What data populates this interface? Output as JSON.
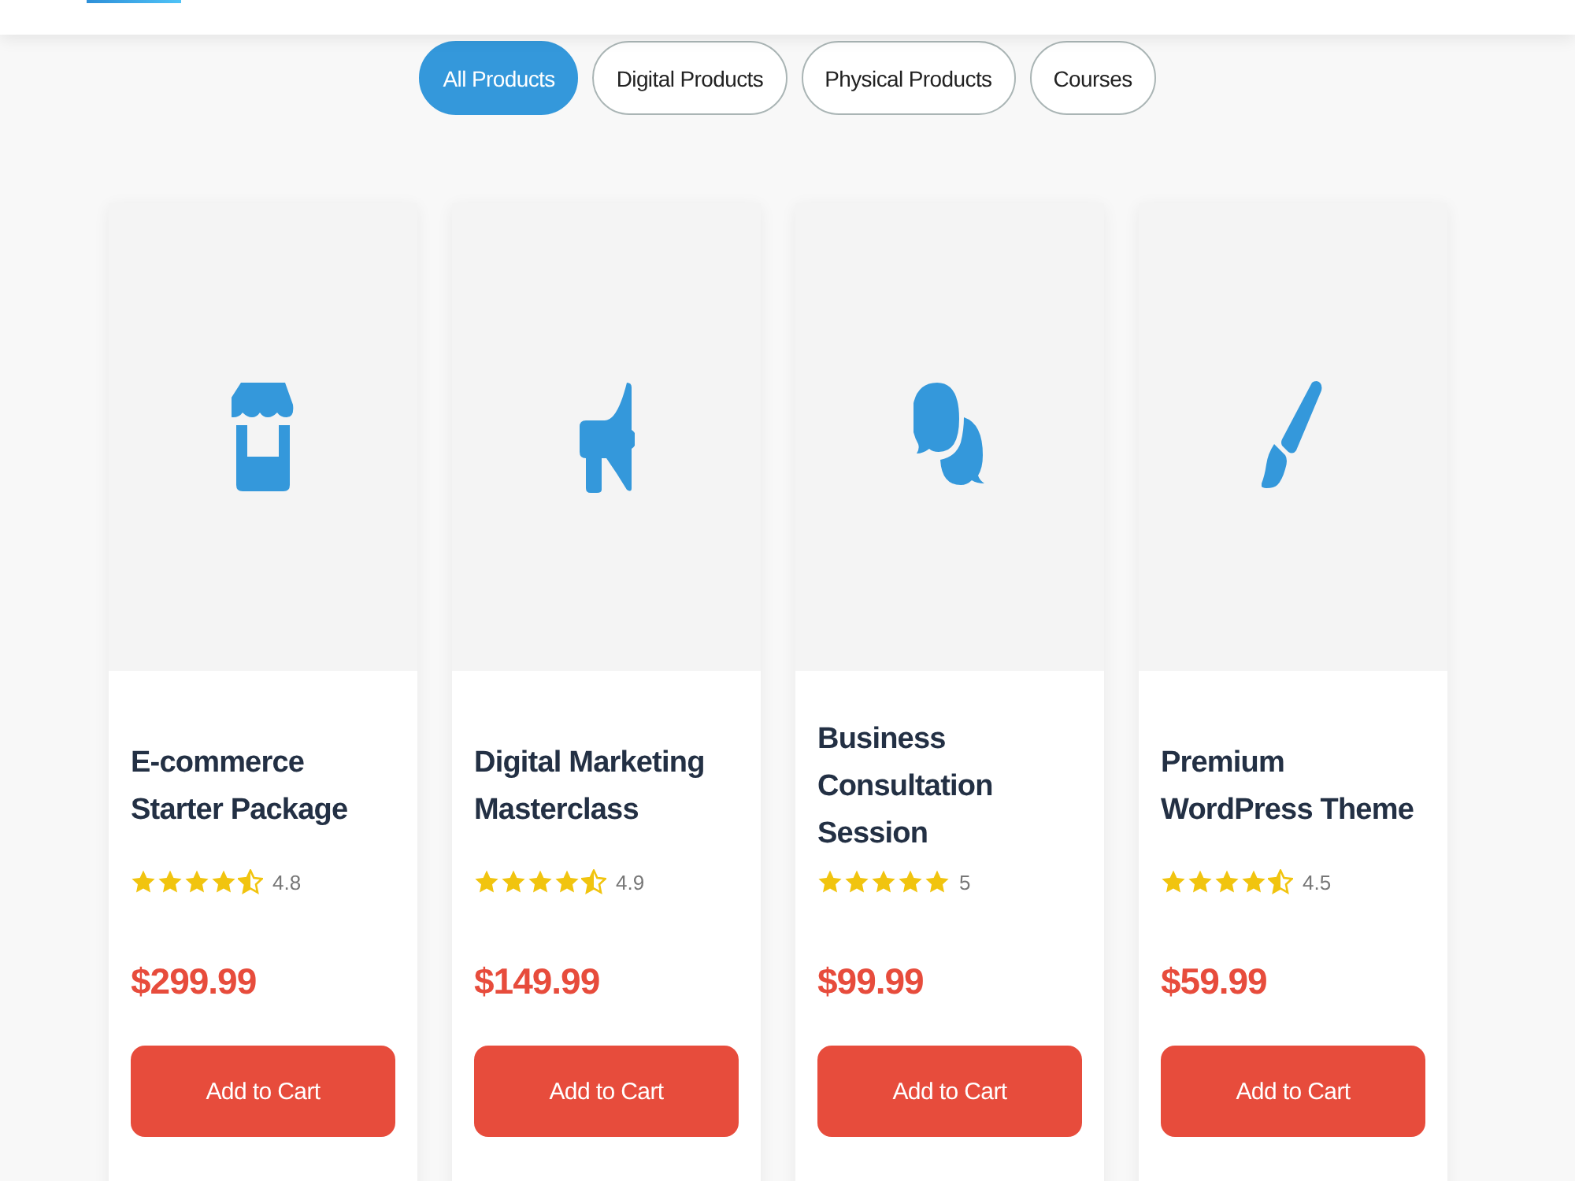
{
  "filters": [
    {
      "label": "All Products",
      "selected": true
    },
    {
      "label": "Digital Products",
      "selected": false
    },
    {
      "label": "Physical Products",
      "selected": false
    },
    {
      "label": "Courses",
      "selected": false
    }
  ],
  "products": [
    {
      "title": "E-commerce Starter Package",
      "stars": 4.5,
      "rating": "4.8",
      "price": "$299.99",
      "button": "Add to Cart"
    },
    {
      "title": "Digital Marketing Masterclass",
      "stars": 4.5,
      "rating": "4.9",
      "price": "$149.99",
      "button": "Add to Cart"
    },
    {
      "title": "Business Consultation Session",
      "stars": 5,
      "rating": "5",
      "price": "$99.99",
      "button": "Add to Cart"
    },
    {
      "title": "Premium WordPress Theme",
      "stars": 4.5,
      "rating": "4.5",
      "price": "$59.99",
      "button": "Add to Cart"
    }
  ]
}
